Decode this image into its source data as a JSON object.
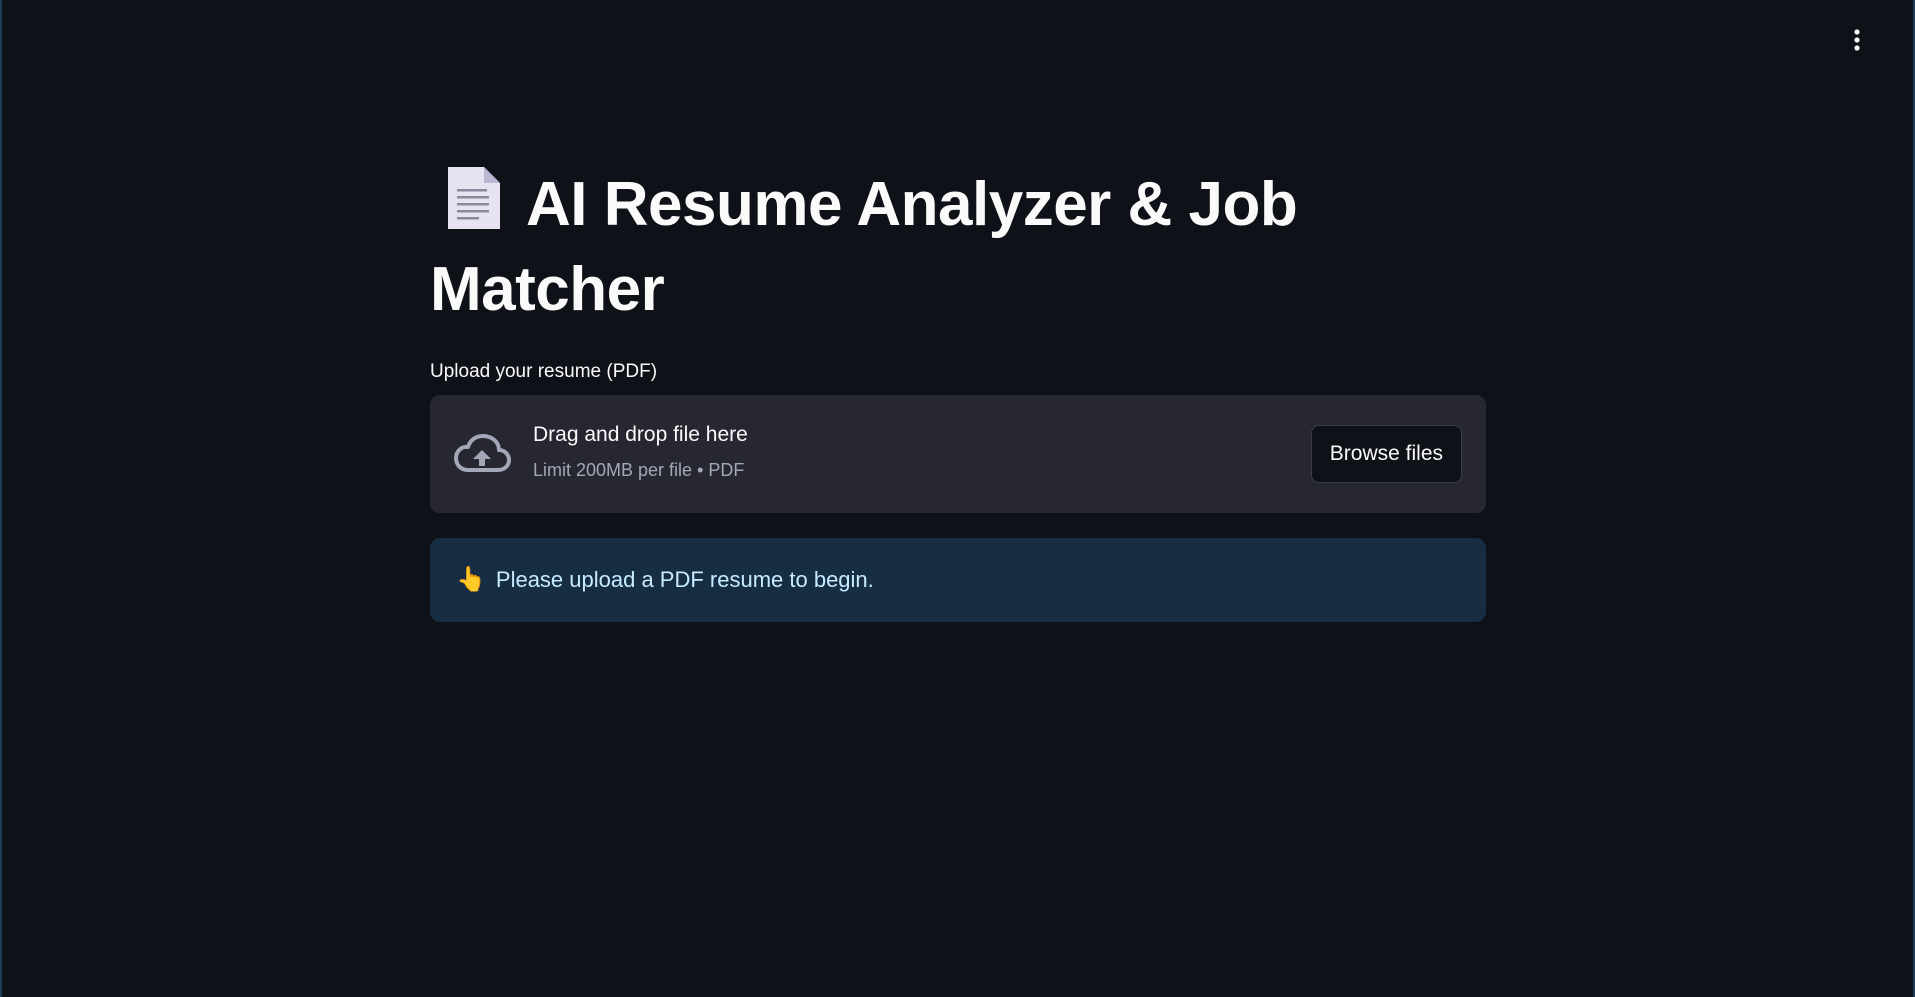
{
  "header": {
    "menu_icon": "vertical-ellipsis-icon"
  },
  "main": {
    "title_icon": "page-document-icon",
    "title": "AI Resume Analyzer & Job Matcher",
    "uploader": {
      "label": "Upload your resume (PDF)",
      "icon": "cloud-upload-icon",
      "drop_text": "Drag and drop file here",
      "limit_text": "Limit 200MB per file • PDF",
      "browse_label": "Browse files"
    },
    "info": {
      "emoji": "👆",
      "message": "Please upload a PDF resume to begin."
    }
  },
  "colors": {
    "background": "#0e1117",
    "dropzone": "#262730",
    "info_background": "#172d43",
    "info_text": "#c7ebff",
    "muted_text": "#a3a8b8"
  }
}
